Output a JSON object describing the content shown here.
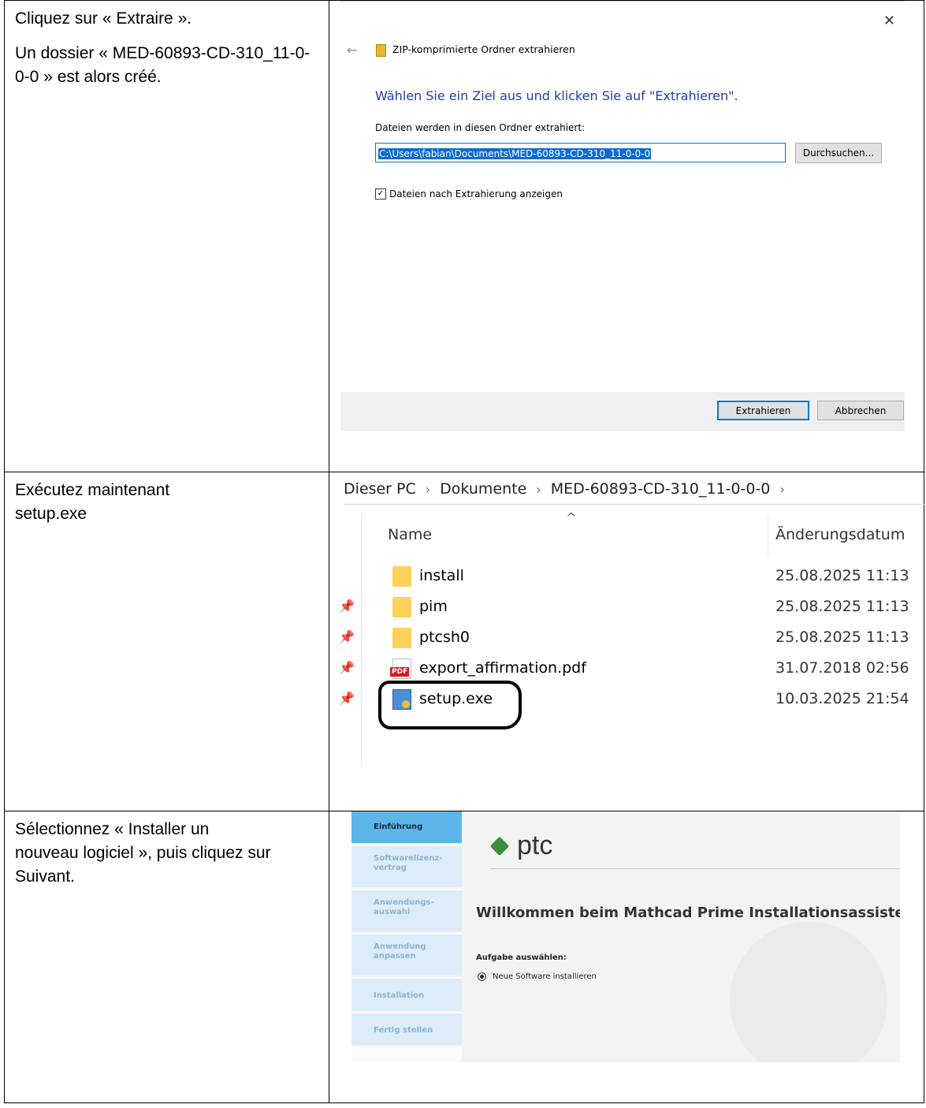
{
  "steps": [
    {
      "lines": [
        "Cliquez sur « Extraire ».",
        "Un dossier « MED-60893-CD-310_11-0-0-0 » est alors créé."
      ]
    },
    {
      "lines": [
        "Exécutez maintenant setup.exe"
      ]
    },
    {
      "lines": [
        "Sélectionnez « Installer un nouveau logiciel », puis cliquez sur Suivant."
      ]
    }
  ],
  "extract_dialog": {
    "close_glyph": "✕",
    "back_glyph": "←",
    "title": "ZIP-komprimierte Ordner extrahieren",
    "heading": "Wählen Sie ein Ziel aus und klicken Sie auf \"Extrahieren\".",
    "folder_label": "Dateien werden in diesen Ordner extrahiert:",
    "folder_value": "C:\\Users\\fabian\\Documents\\MED-60893-CD-310_11-0-0-0",
    "browse_label": "Durchsuchen...",
    "show_files_label": "Dateien nach Extrahierung anzeigen",
    "show_files_checked": true,
    "extract_label": "Extrahieren",
    "cancel_label": "Abbrechen"
  },
  "explorer": {
    "breadcrumb": [
      "Dieser PC",
      "Dokumente",
      "MED-60893-CD-310_11-0-0-0"
    ],
    "separator": "›",
    "sort_glyph": "^",
    "columns": {
      "name": "Name",
      "date": "Änderungsdatum"
    },
    "pin_glyph": "📌",
    "files": [
      {
        "name": "install",
        "date": "25.08.2025 11:13",
        "icon": "folder-icon"
      },
      {
        "name": "pim",
        "date": "25.08.2025 11:13",
        "icon": "folder-icon"
      },
      {
        "name": "ptcsh0",
        "date": "25.08.2025 11:13",
        "icon": "folder-icon"
      },
      {
        "name": "export_affirmation.pdf",
        "date": "31.07.2018 02:56",
        "icon": "pdf-icon"
      },
      {
        "name": "setup.exe",
        "date": "10.03.2025 21:54",
        "icon": "installer-icon"
      }
    ],
    "pdf_badge": "PDF",
    "highlighted_file": "setup.exe"
  },
  "installer": {
    "steps": [
      "Einführung",
      "Softwarelizenz-\nvertrag",
      "Anwendungs-\nauswahl",
      "Anwendung\nanpassen",
      "Installation",
      "Fertig stellen"
    ],
    "active_step": 0,
    "logo_text": "ptc",
    "welcome": "Willkommen beim Mathcad Prime Installationsassistenten",
    "task_label": "Aufgabe auswählen:",
    "option_label": "Neue Software installieren",
    "brand_color": "#3a8d3a",
    "active_step_color": "#5db4e8"
  }
}
